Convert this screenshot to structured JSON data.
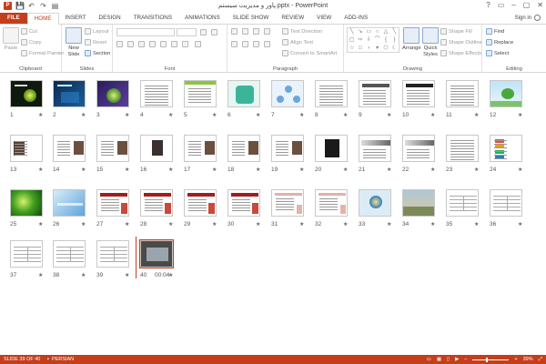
{
  "window": {
    "title": "پاور و مدیریت سیستم.pptx - PowerPoint",
    "controls": [
      "?",
      "▭",
      "–",
      "▢",
      "✕"
    ]
  },
  "qat": [
    "P",
    "💾",
    "↶",
    "↷",
    "▤"
  ],
  "tabs": [
    {
      "id": "file",
      "label": "FILE"
    },
    {
      "id": "home",
      "label": "HOME"
    },
    {
      "id": "insert",
      "label": "INSERT"
    },
    {
      "id": "design",
      "label": "DESIGN"
    },
    {
      "id": "transitions",
      "label": "TRANSITIONS"
    },
    {
      "id": "animations",
      "label": "ANIMATIONS"
    },
    {
      "id": "slideshow",
      "label": "SLIDE SHOW"
    },
    {
      "id": "review",
      "label": "REVIEW"
    },
    {
      "id": "view",
      "label": "VIEW"
    },
    {
      "id": "addins",
      "label": "ADD-INS"
    }
  ],
  "active_tab": "home",
  "signin": "Sign in",
  "ribbon": {
    "clipboard": {
      "label": "Clipboard",
      "paste": "Paste",
      "cut": "Cut",
      "copy": "Copy",
      "painter": "Format Painter"
    },
    "slides": {
      "label": "Slides",
      "new_slide": "New Slide",
      "layout": "Layout",
      "reset": "Reset",
      "section": "Section"
    },
    "font": {
      "label": "Font"
    },
    "paragraph": {
      "label": "Paragraph",
      "text_direction": "Text Direction",
      "align_text": "Align Text",
      "smartart": "Convert to SmartArt"
    },
    "drawing": {
      "label": "Drawing",
      "arrange": "Arrange",
      "quick_styles": "Quick Styles",
      "shape_fill": "Shape Fill",
      "shape_outline": "Shape Outline",
      "shape_effects": "Shape Effects"
    },
    "editing": {
      "label": "Editing",
      "find": "Find",
      "replace": "Replace",
      "select": "Select"
    }
  },
  "slides": [
    {
      "n": "1",
      "type": "dark-green"
    },
    {
      "n": "2",
      "type": "dark-blue"
    },
    {
      "n": "3",
      "type": "purple-light"
    },
    {
      "n": "4",
      "type": "text"
    },
    {
      "n": "5",
      "type": "green-text"
    },
    {
      "n": "6",
      "type": "teal-box"
    },
    {
      "n": "7",
      "type": "diagram-blue"
    },
    {
      "n": "8",
      "type": "text"
    },
    {
      "n": "9",
      "type": "header-text"
    },
    {
      "n": "10",
      "type": "text-dark-title"
    },
    {
      "n": "11",
      "type": "text"
    },
    {
      "n": "12",
      "type": "sky-tree"
    },
    {
      "n": "13",
      "type": "photo-text"
    },
    {
      "n": "14",
      "type": "text-photo"
    },
    {
      "n": "15",
      "type": "text-photo"
    },
    {
      "n": "16",
      "type": "photo-center"
    },
    {
      "n": "17",
      "type": "text-photo"
    },
    {
      "n": "18",
      "type": "text-photo"
    },
    {
      "n": "19",
      "type": "text-photo"
    },
    {
      "n": "20",
      "type": "photo-dark"
    },
    {
      "n": "21",
      "type": "plane"
    },
    {
      "n": "22",
      "type": "plane"
    },
    {
      "n": "23",
      "type": "text"
    },
    {
      "n": "24",
      "type": "colored-bars"
    },
    {
      "n": "25",
      "type": "green-glow"
    },
    {
      "n": "26",
      "type": "blue-waves"
    },
    {
      "n": "27",
      "type": "red-accent"
    },
    {
      "n": "28",
      "type": "red-accent"
    },
    {
      "n": "29",
      "type": "red-accent"
    },
    {
      "n": "30",
      "type": "red-accent"
    },
    {
      "n": "31",
      "type": "pale-accent"
    },
    {
      "n": "32",
      "type": "pale-accent"
    },
    {
      "n": "33",
      "type": "globe"
    },
    {
      "n": "34",
      "type": "landscape"
    },
    {
      "n": "35",
      "type": "table"
    },
    {
      "n": "36",
      "type": "table"
    },
    {
      "n": "37",
      "type": "table"
    },
    {
      "n": "38",
      "type": "table"
    },
    {
      "n": "39",
      "type": "table"
    },
    {
      "n": "40",
      "type": "photo-laptop",
      "duration": "00:04"
    }
  ],
  "selected_slide": "40",
  "status": {
    "slide": "SLIDE 39 OF 40",
    "language": "PERSIAN",
    "zoom": "39%",
    "zoom_fraction": 0.39
  },
  "colors": {
    "accent": "#c43e1c"
  }
}
